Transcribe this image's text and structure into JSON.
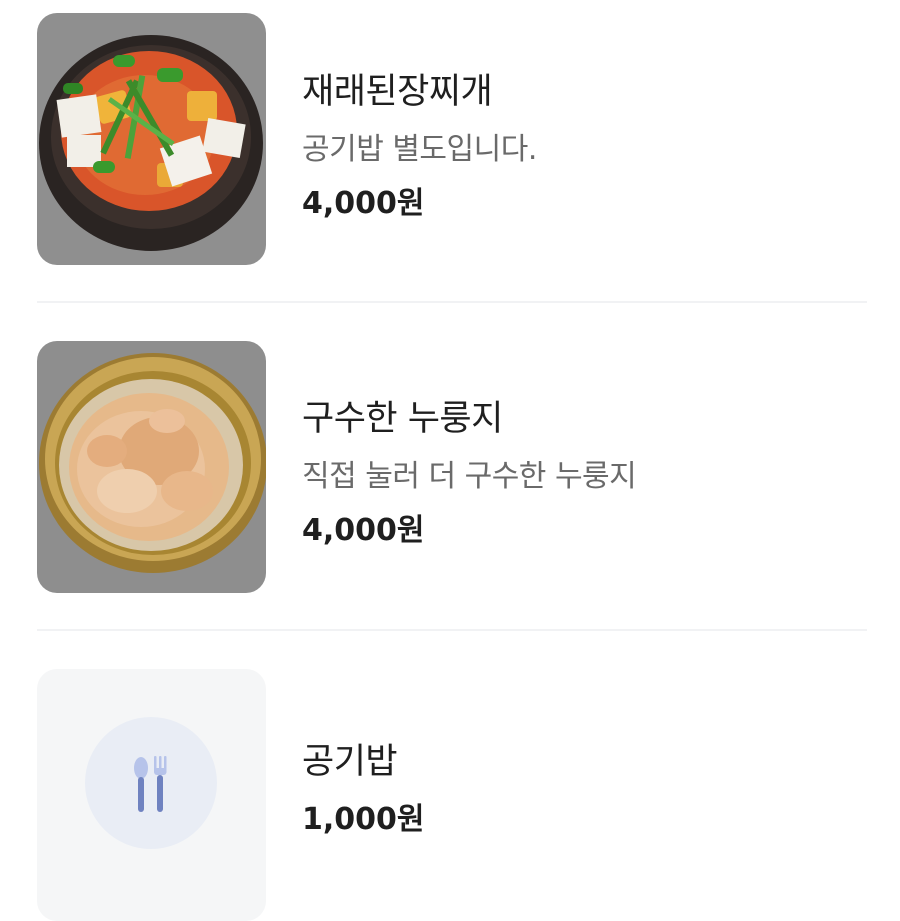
{
  "menu": {
    "items": [
      {
        "name": "재래된장찌개",
        "description": "공기밥 별도입니다.",
        "price": "4,000원",
        "image": "doenjang-stew-photo"
      },
      {
        "name": "구수한 누룽지",
        "description": "직접 눌러 더 구수한 누룽지",
        "price": "4,000원",
        "image": "nurungji-porridge-photo"
      },
      {
        "name": "공기밥",
        "price": "1,000원",
        "image": "utensils-placeholder-icon"
      }
    ]
  },
  "colors": {
    "text_primary": "#1f1f1f",
    "text_secondary": "#6a6a6a",
    "divider": "#f1f2f4",
    "placeholder_bg": "#f5f6f7",
    "placeholder_circle": "#e9edf5",
    "placeholder_icon": "#6f82c0"
  }
}
